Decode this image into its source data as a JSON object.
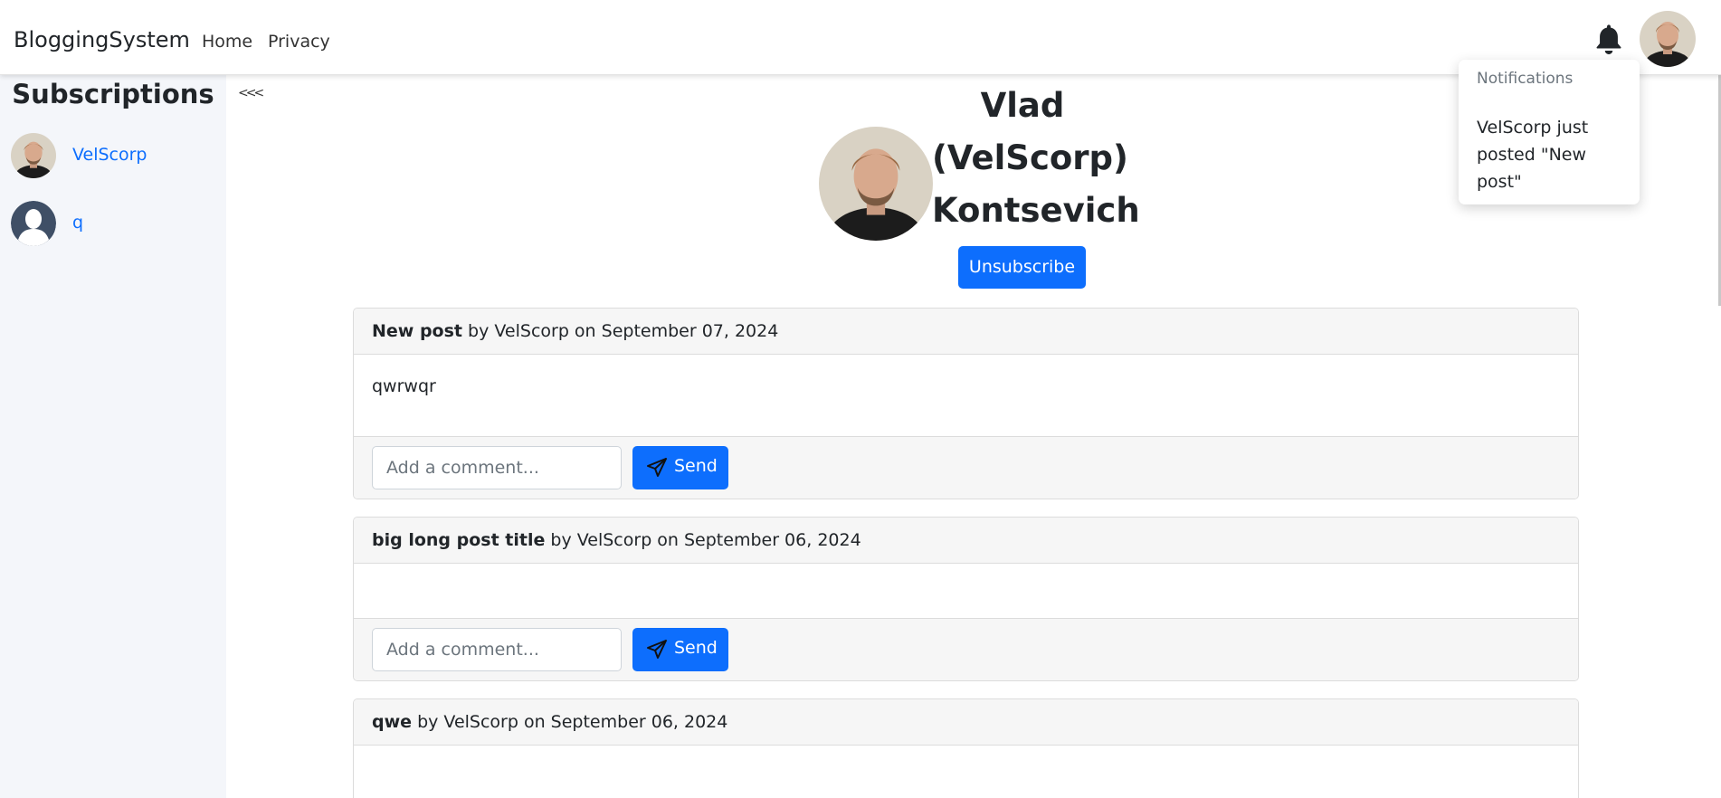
{
  "navbar": {
    "brand": "BloggingSystem",
    "links": [
      "Home",
      "Privacy"
    ],
    "icons": {
      "notifications": "bell-icon",
      "user": "user-avatar"
    }
  },
  "sidebar": {
    "title": "Subscriptions",
    "collapse_label": "<<<",
    "items": [
      {
        "name": "VelScorp",
        "avatar": "photo-avatar"
      },
      {
        "name": "q",
        "avatar": "default-user-silhouette"
      }
    ]
  },
  "profile": {
    "name_line1": "Vlad",
    "name_line2": "(VelScorp)",
    "name_line3": "Kontsevich",
    "unsubscribe_label": "Unsubscribe"
  },
  "posts": [
    {
      "title": "New post",
      "meta": " by VelScorp on September 07, 2024",
      "body": "qwrwqr"
    },
    {
      "title": "big long post title",
      "meta": " by VelScorp on September 06, 2024",
      "body": ""
    },
    {
      "title": "qwe",
      "meta": " by VelScorp on September 06, 2024",
      "body": ""
    }
  ],
  "comment": {
    "placeholder": "Add a comment...",
    "send_label": "Send"
  },
  "notifications": {
    "title": "Notifications",
    "items": [
      "VelScorp just posted \"New post\""
    ]
  },
  "colors": {
    "primary": "#0d6efd",
    "sidebar_bg": "#f4f6fa",
    "card_header_bg": "#f6f6f6"
  }
}
